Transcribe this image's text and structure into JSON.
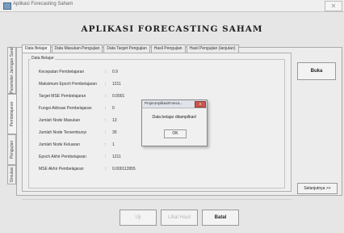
{
  "window": {
    "title": "Aplikasi Forecasting Saham",
    "close_glyph": "✕"
  },
  "heading": "APLIKASI FORECASTING SAHAM",
  "side_tabs": [
    "Simulasi",
    "Pengujian",
    "Pembelajaran",
    "Parameter Jaringan Saraf"
  ],
  "tabs": [
    "Data Belajar",
    "Data Masukan Pengujian",
    "Data Target Pengujian",
    "Hasil Pengujian",
    "Hasil Pengujian (lanjutan)"
  ],
  "group_label": "Data Belajar",
  "fields": [
    {
      "label": "Kecepatan Pembelajaran",
      "value": "0.9"
    },
    {
      "label": "Maksimum Epoch Pembelajaran",
      "value": "1211"
    },
    {
      "label": "Target MSE Pembelajaran",
      "value": "0.0001"
    },
    {
      "label": "Fungsi Aktivasi Pembelajaran",
      "value": "0"
    },
    {
      "label": "Jumlah Node Masukan",
      "value": "13"
    },
    {
      "label": "Jumlah Node Tersembunyi",
      "value": "30"
    },
    {
      "label": "Jumlah Node Keluaran",
      "value": "1"
    },
    {
      "label": "Epoch Akhir Pembelajaran",
      "value": "1211"
    },
    {
      "label": "MSE Akhir Pembelajaran",
      "value": "0.000113955"
    }
  ],
  "colon": ":",
  "buttons": {
    "buka": "Buka",
    "selanjutnya": "Selanjutnya >>",
    "uji": "Uji",
    "lihat_hasil": "Lihat Hasil",
    "batal": "Batal"
  },
  "dialog": {
    "title": "ProjectAplikasiForeca...",
    "close_glyph": "✕",
    "message": "Data belajar ditampilkan!",
    "ok": "OK"
  }
}
